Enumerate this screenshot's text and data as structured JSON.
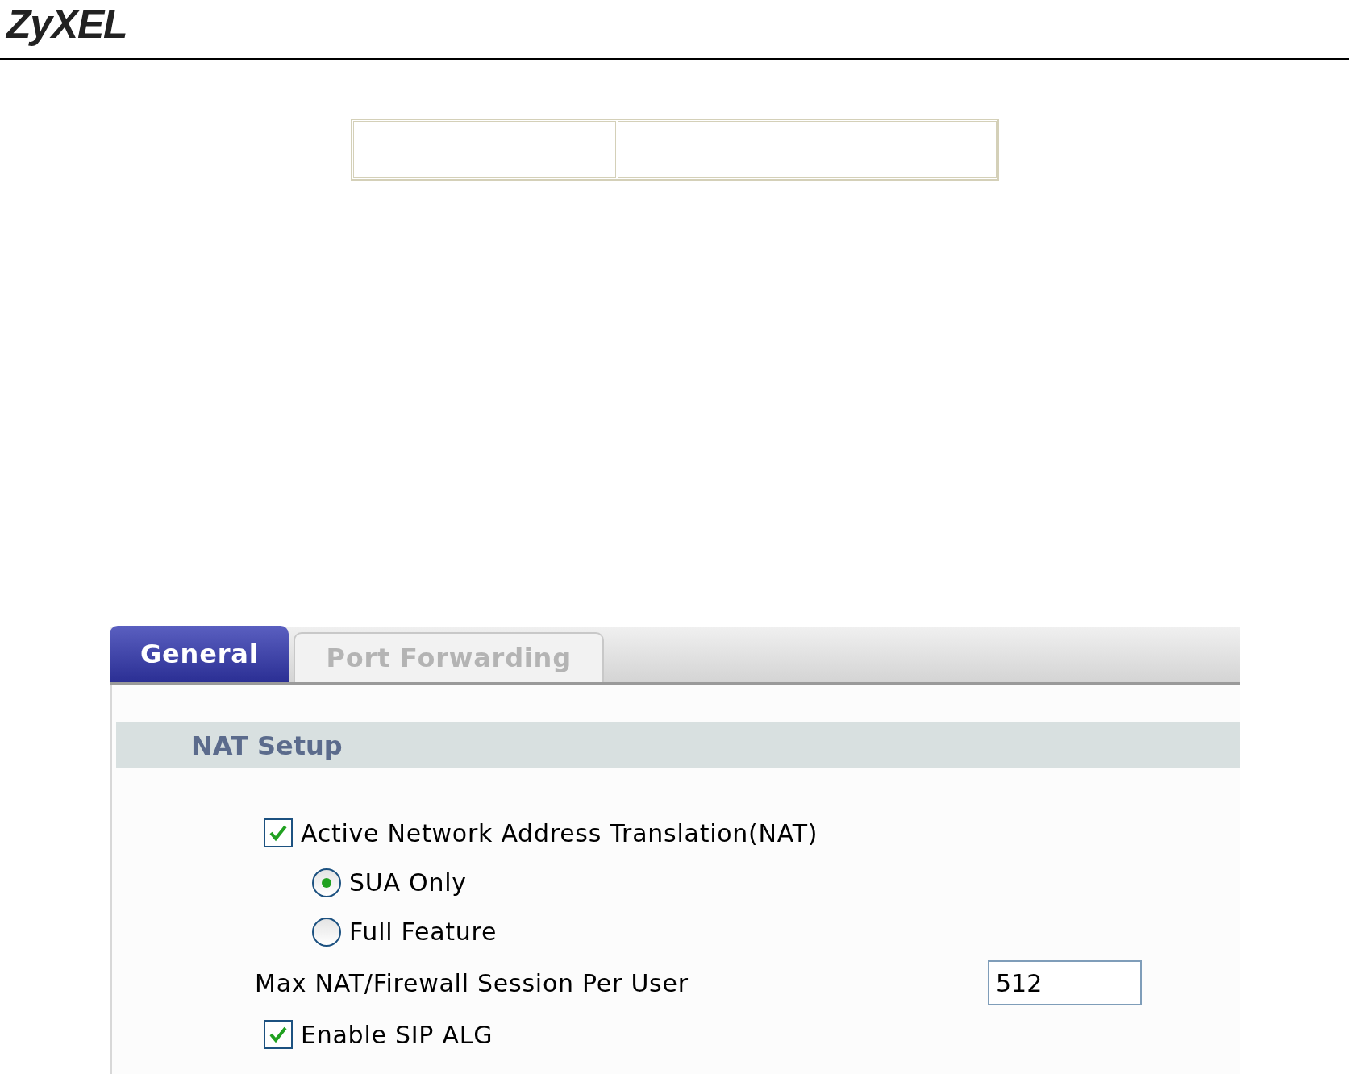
{
  "header": {
    "logo": "ZyXEL"
  },
  "tabs": [
    {
      "label": "General",
      "selected": true
    },
    {
      "label": "Port Forwarding",
      "selected": false
    }
  ],
  "section": {
    "title": "NAT Setup"
  },
  "options": [
    {
      "kind": "checkbox",
      "label": "Active Network Address Translation(NAT)",
      "checked": true
    },
    {
      "kind": "radio",
      "label": "SUA Only",
      "selected": true
    },
    {
      "kind": "radio",
      "label": "Full Feature",
      "selected": false
    },
    {
      "kind": "field",
      "label": "Max NAT/Firewall Session Per User",
      "value": "512"
    },
    {
      "kind": "checkbox",
      "label": "Enable SIP ALG",
      "checked": true
    }
  ]
}
